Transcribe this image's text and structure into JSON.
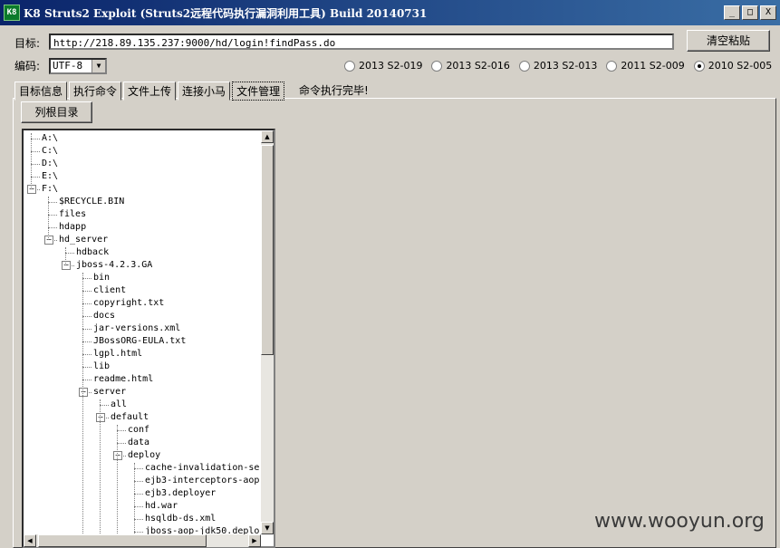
{
  "window": {
    "title": "K8 Struts2 Exploit (Struts2远程代码执行漏洞利用工具) Build 20140731",
    "icon_text": "K8",
    "minimize": "_",
    "maximize": "□",
    "close": "X"
  },
  "form": {
    "target_label": "目标:",
    "target_value": "http://218.89.135.237:9000/hd/login!findPass.do",
    "clear_button": "清空粘贴",
    "encoding_label": "编码:",
    "encoding_value": "UTF-8"
  },
  "radios": [
    {
      "label": "2013 S2-019",
      "checked": false
    },
    {
      "label": "2013 S2-016",
      "checked": false
    },
    {
      "label": "2013 S2-013",
      "checked": false
    },
    {
      "label": "2011 S2-009",
      "checked": false
    },
    {
      "label": "2010 S2-005",
      "checked": true
    }
  ],
  "tabs": [
    {
      "label": "目标信息",
      "active": false
    },
    {
      "label": "执行命令",
      "active": false
    },
    {
      "label": "文件上传",
      "active": false
    },
    {
      "label": "连接小马",
      "active": false
    },
    {
      "label": "文件管理",
      "active": true
    }
  ],
  "status": "命令执行完毕!",
  "list_root_button": "列根目录",
  "tree": [
    {
      "label": "A:\\",
      "level": 0,
      "expandable": false
    },
    {
      "label": "C:\\",
      "level": 0,
      "expandable": false
    },
    {
      "label": "D:\\",
      "level": 0,
      "expandable": false
    },
    {
      "label": "E:\\",
      "level": 0,
      "expandable": false
    },
    {
      "label": "F:\\",
      "level": 0,
      "expandable": true,
      "expanded": true
    },
    {
      "label": "$RECYCLE.BIN",
      "level": 1,
      "expandable": false
    },
    {
      "label": "files",
      "level": 1,
      "expandable": false
    },
    {
      "label": "hdapp",
      "level": 1,
      "expandable": false
    },
    {
      "label": "hd_server",
      "level": 1,
      "expandable": true,
      "expanded": true
    },
    {
      "label": "hdback",
      "level": 2,
      "expandable": false
    },
    {
      "label": "jboss-4.2.3.GA",
      "level": 2,
      "expandable": true,
      "expanded": true
    },
    {
      "label": "bin",
      "level": 3,
      "expandable": false
    },
    {
      "label": "client",
      "level": 3,
      "expandable": false
    },
    {
      "label": "copyright.txt",
      "level": 3,
      "expandable": false
    },
    {
      "label": "docs",
      "level": 3,
      "expandable": false
    },
    {
      "label": "jar-versions.xml",
      "level": 3,
      "expandable": false
    },
    {
      "label": "JBossORG-EULA.txt",
      "level": 3,
      "expandable": false
    },
    {
      "label": "lgpl.html",
      "level": 3,
      "expandable": false
    },
    {
      "label": "lib",
      "level": 3,
      "expandable": false
    },
    {
      "label": "readme.html",
      "level": 3,
      "expandable": false
    },
    {
      "label": "server",
      "level": 3,
      "expandable": true,
      "expanded": true
    },
    {
      "label": "all",
      "level": 4,
      "expandable": false
    },
    {
      "label": "default",
      "level": 4,
      "expandable": true,
      "expanded": true
    },
    {
      "label": "conf",
      "level": 5,
      "expandable": false
    },
    {
      "label": "data",
      "level": 5,
      "expandable": false
    },
    {
      "label": "deploy",
      "level": 5,
      "expandable": true,
      "expanded": true
    },
    {
      "label": "cache-invalidation-se",
      "level": 6,
      "expandable": false
    },
    {
      "label": "ejb3-interceptors-aop",
      "level": 6,
      "expandable": false
    },
    {
      "label": "ejb3.deployer",
      "level": 6,
      "expandable": false
    },
    {
      "label": "hd.war",
      "level": 6,
      "expandable": false
    },
    {
      "label": "hsqldb-ds.xml",
      "level": 6,
      "expandable": false
    },
    {
      "label": "jboss-aop-jdk50.deplo",
      "level": 6,
      "expandable": false
    }
  ],
  "watermark": "www.wooyun.org"
}
